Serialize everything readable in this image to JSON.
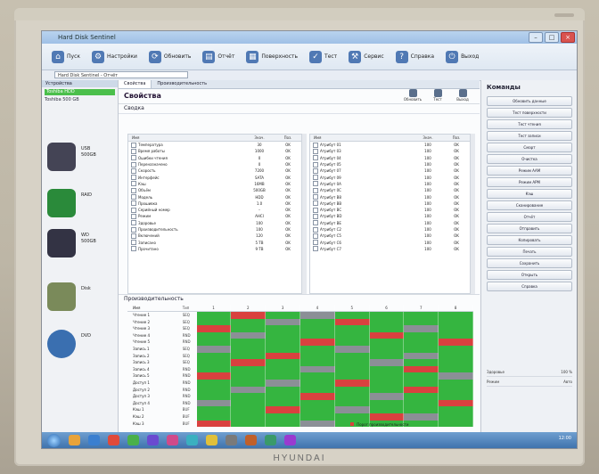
{
  "window": {
    "title": "Hard Disk Sentinel",
    "min": "–",
    "max": "□",
    "close": "×"
  },
  "ribbon": [
    {
      "label": "Пуск"
    },
    {
      "label": "Настройки"
    },
    {
      "label": "Обновить"
    },
    {
      "label": "Отчёт"
    },
    {
      "label": "Поверхность"
    },
    {
      "label": "Тест"
    },
    {
      "label": "Сервис"
    },
    {
      "label": "Справка"
    },
    {
      "label": "Выход"
    }
  ],
  "address": "Hard Disk Sentinel - Отчёт",
  "left": {
    "tab": "Устройства",
    "selected": "Toshiba HDD",
    "sub": "Toshiba 500 GB",
    "devices": [
      {
        "name": "USB",
        "detail": "500GB"
      },
      {
        "name": "RAID",
        "detail": ""
      },
      {
        "name": "WD",
        "detail": "500GB"
      },
      {
        "name": "Disk",
        "detail": ""
      },
      {
        "name": "DVD",
        "detail": ""
      }
    ]
  },
  "main": {
    "tabs": [
      "Свойства",
      "Производительность"
    ],
    "title": "Свойства",
    "tools": [
      "Обновить",
      "Тест",
      "Выход"
    ],
    "subtitle": "Сводка",
    "list1": {
      "headers": [
        "Имя",
        "Знач.",
        "Поз."
      ],
      "rows": [
        {
          "name": "Температура",
          "a": "30",
          "b": "OK"
        },
        {
          "name": "Время работы",
          "a": "1000",
          "b": "OK"
        },
        {
          "name": "Ошибки чтения",
          "a": "0",
          "b": "OK"
        },
        {
          "name": "Переназначено",
          "a": "0",
          "b": "OK"
        },
        {
          "name": "Скорость",
          "a": "7200",
          "b": "OK"
        },
        {
          "name": "Интерфейс",
          "a": "SATA",
          "b": "OK"
        },
        {
          "name": "Кэш",
          "a": "16MB",
          "b": "OK"
        },
        {
          "name": "Объём",
          "a": "500GB",
          "b": "OK"
        },
        {
          "name": "Модель",
          "a": "HDD",
          "b": "OK"
        },
        {
          "name": "Прошивка",
          "a": "1.0",
          "b": "OK"
        },
        {
          "name": "Серийный номер",
          "a": "–",
          "b": "OK"
        },
        {
          "name": "Режим",
          "a": "AHCI",
          "b": "OK"
        },
        {
          "name": "Здоровье",
          "a": "100",
          "b": "OK"
        },
        {
          "name": "Производительность",
          "a": "100",
          "b": "OK"
        },
        {
          "name": "Включений",
          "a": "120",
          "b": "OK"
        },
        {
          "name": "Записано",
          "a": "5 TB",
          "b": "OK"
        },
        {
          "name": "Прочитано",
          "a": "9 TB",
          "b": "OK"
        }
      ]
    },
    "list2": {
      "headers": [
        "Имя",
        "Знач.",
        "Поз."
      ],
      "rows": [
        {
          "name": "Атрибут 01",
          "a": "100",
          "b": "OK"
        },
        {
          "name": "Атрибут 03",
          "a": "100",
          "b": "OK"
        },
        {
          "name": "Атрибут 04",
          "a": "100",
          "b": "OK"
        },
        {
          "name": "Атрибут 05",
          "a": "100",
          "b": "OK"
        },
        {
          "name": "Атрибут 07",
          "a": "100",
          "b": "OK"
        },
        {
          "name": "Атрибут 09",
          "a": "100",
          "b": "OK"
        },
        {
          "name": "Атрибут 0A",
          "a": "100",
          "b": "OK"
        },
        {
          "name": "Атрибут 0C",
          "a": "100",
          "b": "OK"
        },
        {
          "name": "Атрибут B8",
          "a": "100",
          "b": "OK"
        },
        {
          "name": "Атрибут BB",
          "a": "100",
          "b": "OK"
        },
        {
          "name": "Атрибут BC",
          "a": "100",
          "b": "OK"
        },
        {
          "name": "Атрибут BD",
          "a": "100",
          "b": "OK"
        },
        {
          "name": "Атрибут BE",
          "a": "100",
          "b": "OK"
        },
        {
          "name": "Атрибут C2",
          "a": "100",
          "b": "OK"
        },
        {
          "name": "Атрибут C5",
          "a": "100",
          "b": "OK"
        },
        {
          "name": "Атрибут C6",
          "a": "100",
          "b": "OK"
        },
        {
          "name": "Атрибут C7",
          "a": "100",
          "b": "OK"
        }
      ]
    },
    "perf_title": "Производительность",
    "perf_headers": [
      "Имя",
      "Тип",
      "1",
      "2",
      "3",
      "4",
      "5",
      "6",
      "7",
      "8"
    ],
    "perf_rows": [
      {
        "name": "Чтение 1",
        "type": "SEQ",
        "cells": [
          "g",
          "r",
          "g",
          "y",
          "g",
          "g",
          "g",
          "g"
        ]
      },
      {
        "name": "Чтение 2",
        "type": "SEQ",
        "cells": [
          "g",
          "g",
          "y",
          "g",
          "r",
          "g",
          "g",
          "g"
        ]
      },
      {
        "name": "Чтение 3",
        "type": "SEQ",
        "cells": [
          "r",
          "g",
          "g",
          "g",
          "g",
          "g",
          "y",
          "g"
        ]
      },
      {
        "name": "Чтение 4",
        "type": "RND",
        "cells": [
          "g",
          "y",
          "g",
          "g",
          "g",
          "r",
          "g",
          "g"
        ]
      },
      {
        "name": "Чтение 5",
        "type": "RND",
        "cells": [
          "g",
          "g",
          "g",
          "r",
          "g",
          "g",
          "g",
          "r"
        ]
      },
      {
        "name": "Запись 1",
        "type": "SEQ",
        "cells": [
          "y",
          "g",
          "g",
          "g",
          "y",
          "g",
          "g",
          "g"
        ]
      },
      {
        "name": "Запись 2",
        "type": "SEQ",
        "cells": [
          "g",
          "g",
          "r",
          "g",
          "g",
          "g",
          "y",
          "g"
        ]
      },
      {
        "name": "Запись 3",
        "type": "SEQ",
        "cells": [
          "g",
          "r",
          "g",
          "g",
          "g",
          "y",
          "g",
          "g"
        ]
      },
      {
        "name": "Запись 4",
        "type": "RND",
        "cells": [
          "g",
          "g",
          "g",
          "y",
          "g",
          "g",
          "r",
          "g"
        ]
      },
      {
        "name": "Запись 5",
        "type": "RND",
        "cells": [
          "r",
          "g",
          "g",
          "g",
          "g",
          "g",
          "g",
          "y"
        ]
      },
      {
        "name": "Доступ 1",
        "type": "RND",
        "cells": [
          "g",
          "g",
          "y",
          "g",
          "r",
          "g",
          "g",
          "g"
        ]
      },
      {
        "name": "Доступ 2",
        "type": "RND",
        "cells": [
          "g",
          "y",
          "g",
          "g",
          "g",
          "g",
          "r",
          "g"
        ]
      },
      {
        "name": "Доступ 3",
        "type": "RND",
        "cells": [
          "g",
          "g",
          "g",
          "r",
          "g",
          "y",
          "g",
          "g"
        ]
      },
      {
        "name": "Доступ 4",
        "type": "RND",
        "cells": [
          "y",
          "g",
          "g",
          "g",
          "g",
          "g",
          "g",
          "r"
        ]
      },
      {
        "name": "Кэш 1",
        "type": "BUF",
        "cells": [
          "g",
          "g",
          "r",
          "g",
          "y",
          "g",
          "g",
          "g"
        ]
      },
      {
        "name": "Кэш 2",
        "type": "BUF",
        "cells": [
          "g",
          "g",
          "g",
          "g",
          "g",
          "r",
          "y",
          "g"
        ]
      },
      {
        "name": "Кэш 3",
        "type": "BUF",
        "cells": [
          "r",
          "g",
          "g",
          "y",
          "g",
          "g",
          "g",
          "g"
        ]
      }
    ],
    "legend": "Порог производительности"
  },
  "right": {
    "title": "Команды",
    "commands": [
      "Обновить данные",
      "Тест поверхности",
      "Тест чтения",
      "Тест записи",
      "Смарт",
      "Очистка",
      "Режим AAM",
      "Режим APM",
      "Кэш",
      "Сканирование",
      "Отчёт",
      "Отправить",
      "Копировать",
      "Печать",
      "Сохранить",
      "Открыть",
      "Справка"
    ],
    "foot": [
      {
        "k": "Здоровье",
        "v": "100 %"
      },
      {
        "k": "Режим",
        "v": "Авто"
      }
    ]
  },
  "taskbar": {
    "clock": "12:00"
  },
  "monitor_brand": "HYUNDAI",
  "colors": {
    "good": "#35b540",
    "bad": "#d9413f",
    "neutral": "#8b8f96"
  }
}
